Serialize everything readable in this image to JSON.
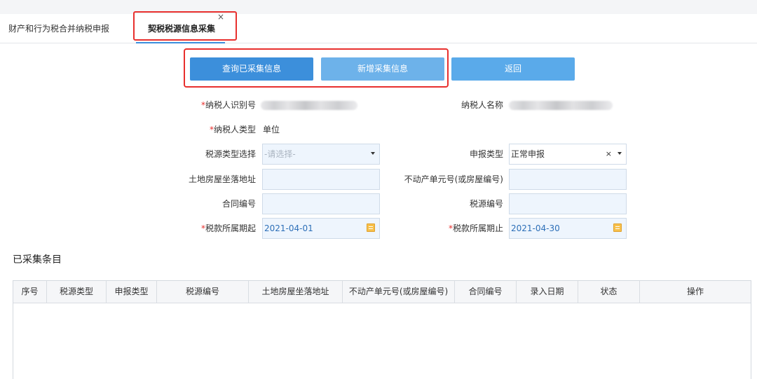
{
  "tabs": [
    {
      "label": "财产和行为税合并纳税申报",
      "active": false
    },
    {
      "label": "契税税源信息采集",
      "active": true,
      "close": "×"
    }
  ],
  "buttons": {
    "query": "查询已采集信息",
    "add": "新增采集信息",
    "back": "返回"
  },
  "form": {
    "taxpayer_id_label": "纳税人识别号",
    "taxpayer_name_label": "纳税人名称",
    "taxpayer_type_label": "纳税人类型",
    "taxpayer_type_value": "单位",
    "source_type_label": "税源类型选择",
    "source_type_placeholder": "-请选择-",
    "declare_type_label": "申报类型",
    "declare_type_value": "正常申报",
    "declare_type_clear": "×",
    "address_label": "土地房屋坐落地址",
    "realestate_label": "不动产单元号(或房屋编号)",
    "contract_label": "合同编号",
    "source_no_label": "税源编号",
    "period_start_label": "税款所属期起",
    "period_start_value": "2021-04-01",
    "period_end_label": "税款所属期止",
    "period_end_value": "2021-04-30",
    "required_mark": "*"
  },
  "section_title": "已采集条目",
  "table": {
    "columns": [
      "序号",
      "税源类型",
      "申报类型",
      "税源编号",
      "土地房屋坐落地址",
      "不动产单元号(或房屋编号)",
      "合同编号",
      "录入日期",
      "状态",
      "操作"
    ],
    "rows": []
  },
  "colors": {
    "accent": "#3c8fdb",
    "highlight": "#e8302e",
    "required": "#e8302e",
    "date_text": "#2d6fb8"
  },
  "icons": [
    "close-icon",
    "chevron-down-icon",
    "calendar-icon"
  ]
}
